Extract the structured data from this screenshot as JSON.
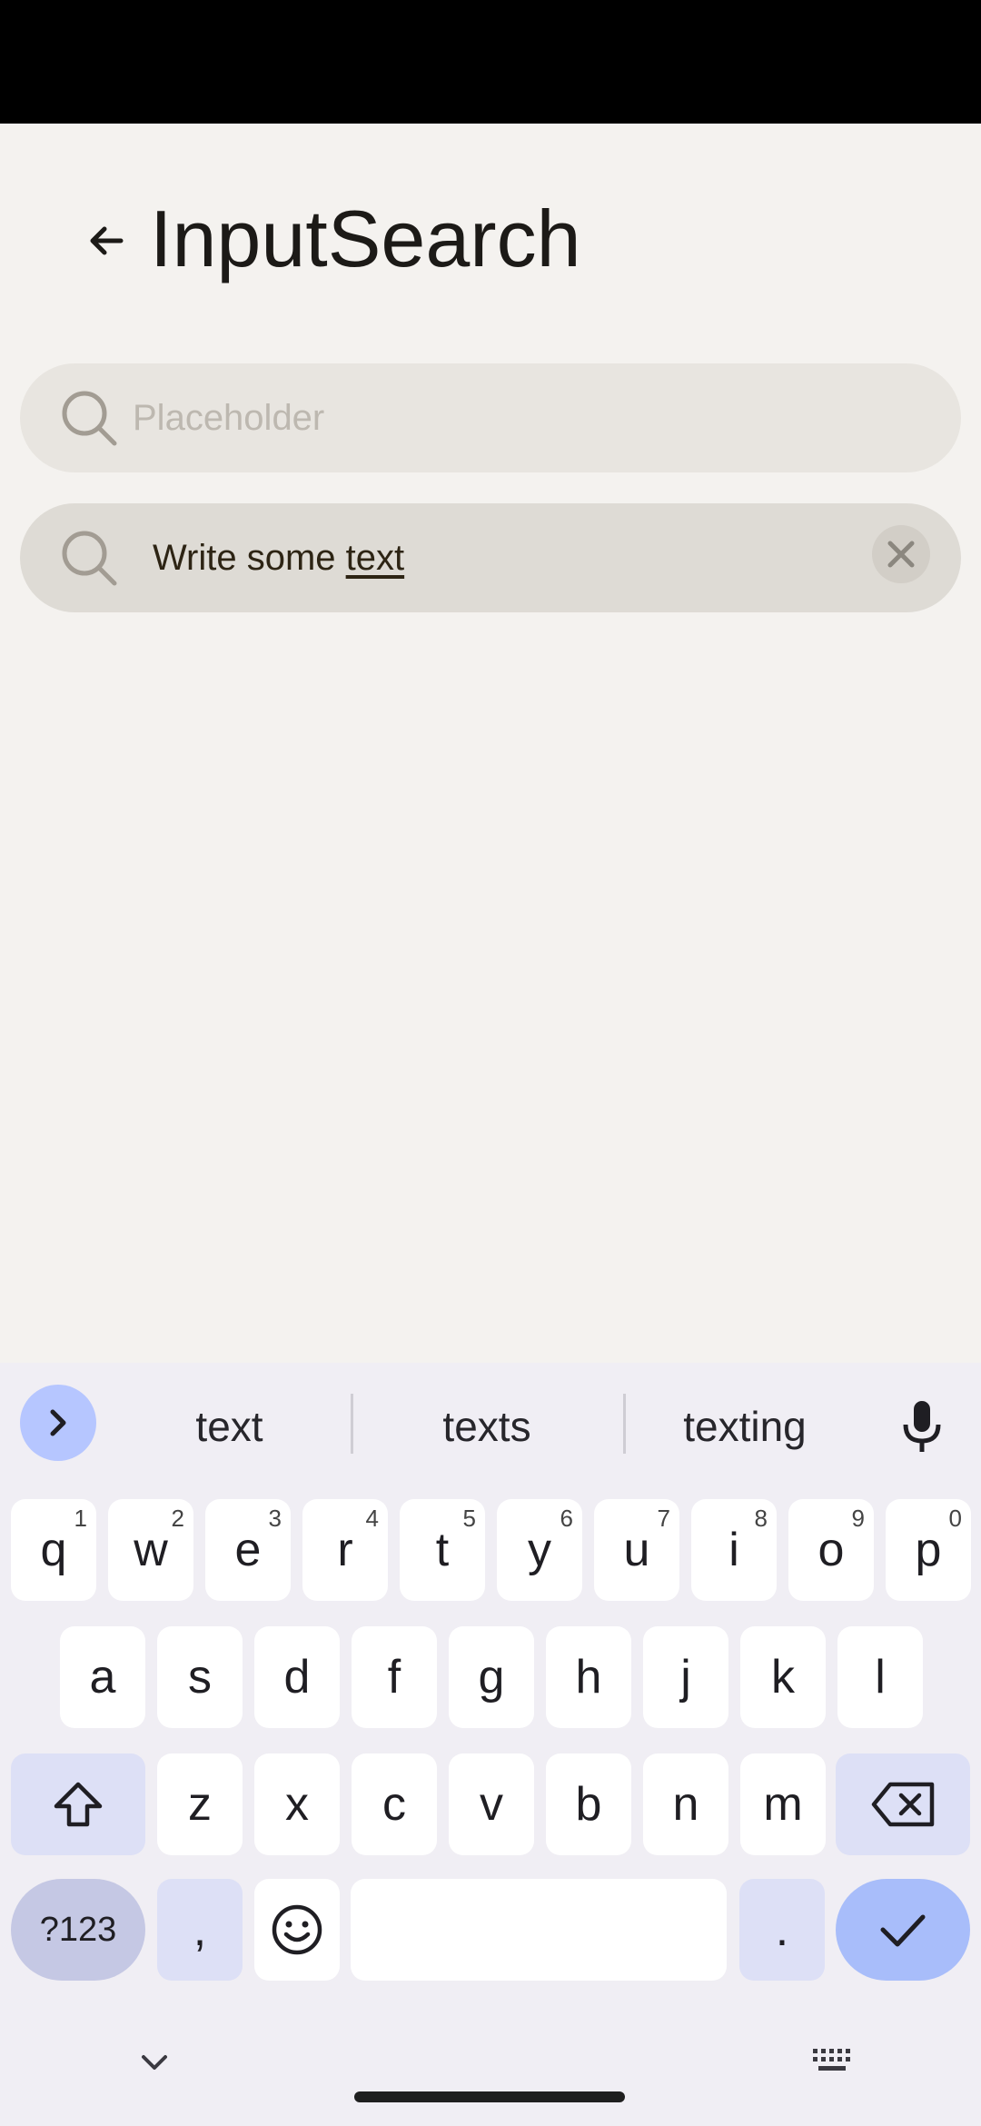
{
  "header": {
    "title": "InputSearch"
  },
  "search_empty": {
    "placeholder": "Placeholder",
    "value": ""
  },
  "search_filled": {
    "text_prefix": "Write some ",
    "text_underlined": "text"
  },
  "keyboard": {
    "suggestions": [
      "text",
      "texts",
      "texting"
    ],
    "row1": [
      {
        "label": "q",
        "hint": "1"
      },
      {
        "label": "w",
        "hint": "2"
      },
      {
        "label": "e",
        "hint": "3"
      },
      {
        "label": "r",
        "hint": "4"
      },
      {
        "label": "t",
        "hint": "5"
      },
      {
        "label": "y",
        "hint": "6"
      },
      {
        "label": "u",
        "hint": "7"
      },
      {
        "label": "i",
        "hint": "8"
      },
      {
        "label": "o",
        "hint": "9"
      },
      {
        "label": "p",
        "hint": "0"
      }
    ],
    "row2": [
      "a",
      "s",
      "d",
      "f",
      "g",
      "h",
      "j",
      "k",
      "l"
    ],
    "row3": [
      "z",
      "x",
      "c",
      "v",
      "b",
      "n",
      "m"
    ],
    "symbols_label": "?123",
    "comma_label": ",",
    "period_label": "."
  },
  "colors": {
    "background": "#f4f2ef",
    "search_bg": "#e8e5e0",
    "search_filled_bg": "#dedbd5",
    "accent_blue": "#a8bdfa"
  }
}
